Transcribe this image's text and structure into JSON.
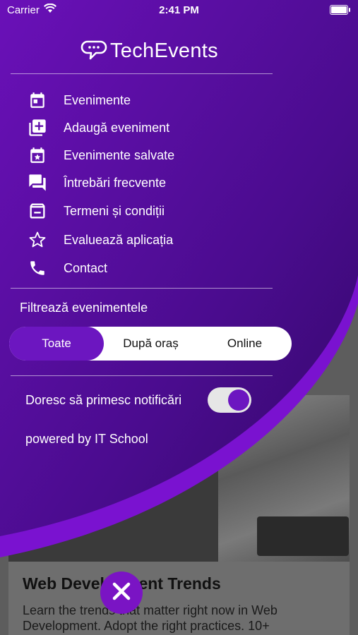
{
  "status_bar": {
    "carrier": "Carrier",
    "time": "2:41 PM"
  },
  "app": {
    "title": "TechEvents"
  },
  "menu": {
    "items": [
      {
        "label": "Evenimente",
        "icon": "calendar-icon"
      },
      {
        "label": "Adaugă eveniment",
        "icon": "add-box-icon"
      },
      {
        "label": "Evenimente salvate",
        "icon": "calendar-star-icon"
      },
      {
        "label": "Întrebări frecvente",
        "icon": "forum-icon"
      },
      {
        "label": "Termeni și condiții",
        "icon": "inbox-icon"
      },
      {
        "label": "Evaluează aplicația",
        "icon": "star-outline-icon"
      },
      {
        "label": "Contact",
        "icon": "phone-icon"
      }
    ]
  },
  "filter": {
    "title": "Filtrează evenimentele",
    "options": [
      "Toate",
      "După oraș",
      "Online"
    ],
    "selected": "Toate"
  },
  "notifications": {
    "label": "Doresc să primesc notificări",
    "enabled": true
  },
  "footer": {
    "powered_by": "powered by IT School"
  },
  "background_card": {
    "title": "Web Development Trends",
    "text": "Learn the trends that matter right now in Web Development. Adopt the right practices.  10+"
  },
  "colors": {
    "accent": "#6c16c0",
    "drawer_top": "#6b0fb8",
    "drawer_bottom": "#3a0a72"
  }
}
